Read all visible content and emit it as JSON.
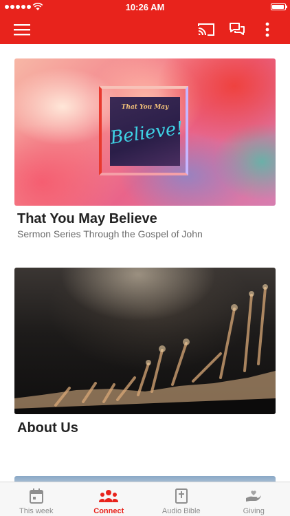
{
  "status_bar": {
    "time": "10:26 AM"
  },
  "app_bar": {
    "menu_icon": "hamburger-menu-icon",
    "cast_icon": "cast-icon",
    "chat_icon": "chat-bubbles-icon",
    "more_icon": "more-vertical-icon"
  },
  "colors": {
    "brand": "#e8231c",
    "tab_inactive": "#8e8e8e",
    "title_text": "#222222",
    "subtitle_text": "#6b6b6b"
  },
  "cards": [
    {
      "image_text": {
        "line1": "That You May",
        "line2": "Believe!"
      },
      "title": "That You May Believe",
      "subtitle": "Sermon Series Through the Gospel of John"
    },
    {
      "title": "About Us"
    }
  ],
  "tabs": [
    {
      "label": "This week",
      "icon": "calendar-icon",
      "active": false
    },
    {
      "label": "Connect",
      "icon": "people-group-icon",
      "active": true
    },
    {
      "label": "Audio Bible",
      "icon": "bible-icon",
      "active": false
    },
    {
      "label": "Giving",
      "icon": "giving-hand-icon",
      "active": false
    }
  ]
}
